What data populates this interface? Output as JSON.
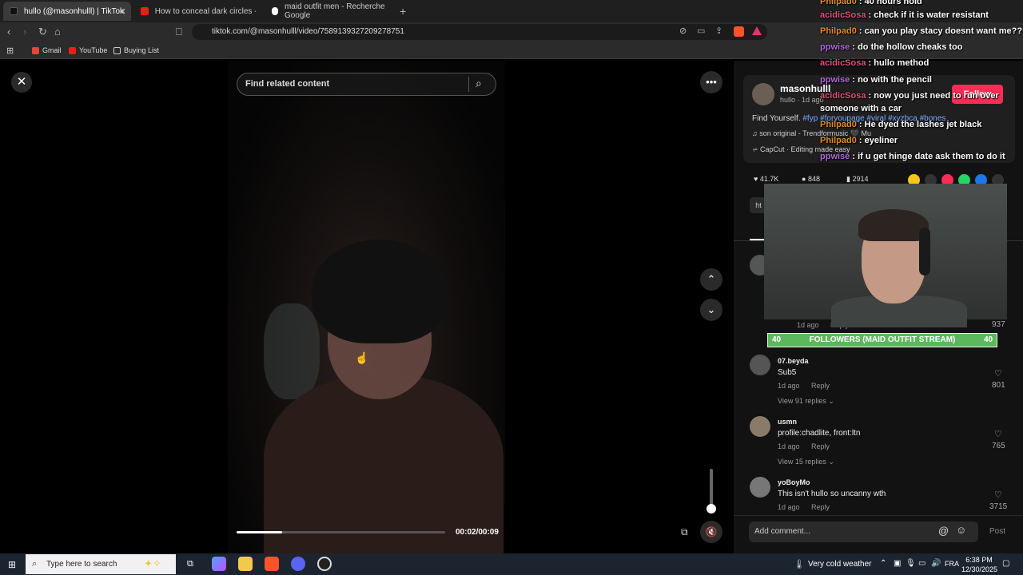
{
  "browser": {
    "tabs": [
      {
        "title": "hullo (@masonhulll) | TikTok",
        "active": true
      },
      {
        "title": "How to conceal dark circles - YouTub",
        "active": false
      },
      {
        "title": "maid outfit men - Recherche Google",
        "active": false
      }
    ],
    "url": "tiktok.com/@masonhulll/video/7589139327209278751",
    "bookmarks": [
      "Gmail",
      "YouTube",
      "Buying List"
    ]
  },
  "player": {
    "search_placeholder": "Find related content",
    "time": "00:02/00:09",
    "progress": 0.22,
    "volume": 0.1
  },
  "video_info": {
    "creator_name": "masonhulll",
    "creator_sub": "hullo · 1d ago",
    "follow_label": "Follow",
    "desc_text": "Find Yourself. ",
    "desc_tags": "#fyp #foryoupage #viral #xyzbca #bones",
    "music": "♫  son original - Trendformusic 🖤 Mu",
    "capcut": "CapCut · Editing made easy",
    "likes": "41.7K",
    "comments": "848",
    "saves": "2914",
    "link_label": "ht"
  },
  "comments": [
    {
      "name": "",
      "text": "",
      "age": "1d ago",
      "reply": "Reply",
      "likes": "937",
      "replies": ""
    },
    {
      "name": "07.beyda",
      "text": "Sub5",
      "age": "1d ago",
      "reply": "Reply",
      "likes": "801",
      "replies": "View 91 replies ⌄"
    },
    {
      "name": "usmn",
      "text": "profile:chadlite, front:ltn",
      "age": "1d ago",
      "reply": "Reply",
      "likes": "765",
      "replies": "View 15 replies ⌄"
    },
    {
      "name": "yoBoyMo",
      "text": "This isn't hullo so uncanny wth",
      "age": "1d ago",
      "reply": "Reply",
      "likes": "3715",
      "replies": ""
    }
  ],
  "comment_bar": {
    "placeholder": "Add comment...",
    "post": "Post"
  },
  "chat": [
    {
      "user": "Philpad0",
      "color": "#e38b2c",
      "msg": " : 40 hours hold"
    },
    {
      "user": "acidicSosa",
      "color": "#e0507a",
      "msg": " : check if it is water resistant"
    },
    {
      "user": "Philpad0",
      "color": "#e38b2c",
      "msg": " : can you play stacy doesnt want me????"
    },
    {
      "user": "ppwise",
      "color": "#b06ad8",
      "msg": " : do the hollow cheaks too"
    },
    {
      "user": "acidicSosa",
      "color": "#e0507a",
      "msg": " : hullo method"
    },
    {
      "user": "ppwise",
      "color": "#b06ad8",
      "msg": " : no with the pencil"
    },
    {
      "user": "acidicSosa",
      "color": "#e0507a",
      "msg": " : now you just need to run over"
    },
    {
      "user": "",
      "color": "#ffffff",
      "msg": "someone with a car"
    },
    {
      "user": "Philpad0",
      "color": "#e38b2c",
      "msg": " : He dyed the lashes jet black"
    },
    {
      "user": "Philpad0",
      "color": "#e38b2c",
      "msg": " : eyeliner"
    },
    {
      "user": "ppwise",
      "color": "#b06ad8",
      "msg": " : if u get hinge date ask them to do it"
    }
  ],
  "followers_goal": {
    "left": "40",
    "label": "FOLLOWERS (MAID OUTFIT STREAM)",
    "right": "40"
  },
  "taskbar": {
    "search_placeholder": "Type here to search",
    "weather": "Very cold weather",
    "lang": "FRA",
    "time": "6:38 PM",
    "date": "12/30/2025"
  },
  "colors": {
    "follow": "#fe2c55",
    "goal_bar": "#5cb85c",
    "tags": "#7aa7ff"
  }
}
